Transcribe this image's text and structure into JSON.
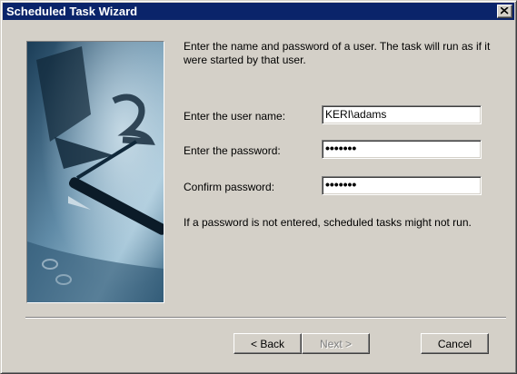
{
  "window": {
    "title": "Scheduled Task Wizard",
    "close_glyph": "×"
  },
  "content": {
    "intro": "Enter the name and password of a user.  The task will run as if it were started by that user.",
    "username_label": "Enter the user name:",
    "username_value": "KERI\\adams",
    "password_label": "Enter the password:",
    "password_value": "•••••••",
    "confirm_label": "Confirm password:",
    "confirm_value": "•••••••",
    "note": "If a password is not entered, scheduled tasks might not run."
  },
  "buttons": {
    "back": "< Back",
    "next": "Next >",
    "cancel": "Cancel"
  },
  "colors": {
    "titlebar": "#0a246a",
    "dialog_face": "#d4d0c8"
  }
}
